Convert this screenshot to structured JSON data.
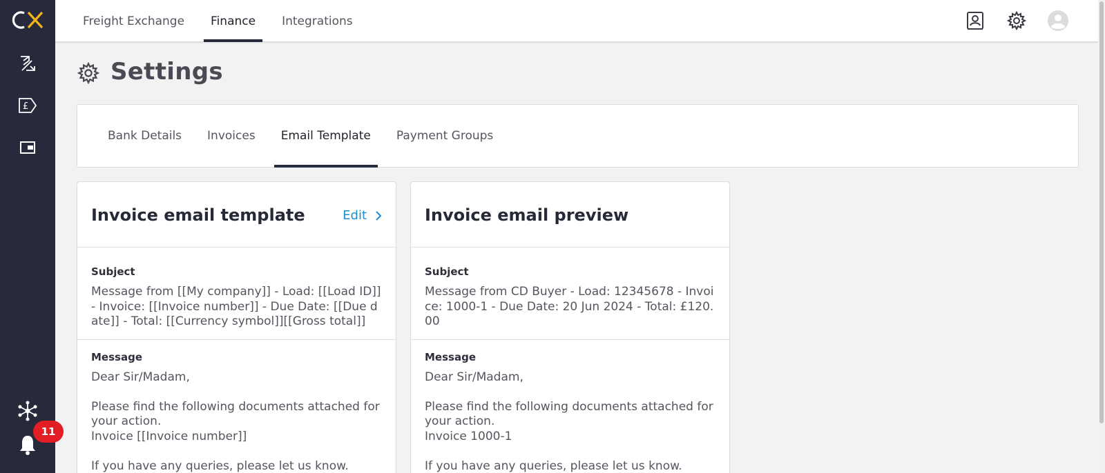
{
  "app": {
    "logo_text": "CX"
  },
  "topnav": {
    "items": [
      {
        "label": "Freight Exchange",
        "active": false
      },
      {
        "label": "Finance",
        "active": true
      },
      {
        "label": "Integrations",
        "active": false
      }
    ]
  },
  "rail": {
    "notifications_count": "11"
  },
  "page": {
    "title": "Settings"
  },
  "tabs": [
    {
      "label": "Bank Details",
      "active": false
    },
    {
      "label": "Invoices",
      "active": false
    },
    {
      "label": "Email Template",
      "active": true
    },
    {
      "label": "Payment Groups",
      "active": false
    }
  ],
  "template_card": {
    "title": "Invoice email template",
    "edit_label": "Edit",
    "subject_label": "Subject",
    "subject_value": "Message from [[My company]] - Load: [[Load ID]] - Invoice: [[Invoice number]] - Due Date: [[Due date]] - Total: [[Currency symbol]][[Gross total]]",
    "message_label": "Message",
    "message_value": "Dear Sir/Madam,\n\nPlease find the following documents attached for your action.\nInvoice [[Invoice number]]\n\nIf you have any queries, please let us know."
  },
  "preview_card": {
    "title": "Invoice email preview",
    "subject_label": "Subject",
    "subject_value": "Message from CD Buyer - Load: 12345678 - Invoice: 1000-1 - Due Date: 20 Jun 2024 - Total: £120.00",
    "message_label": "Message",
    "message_value": "Dear Sir/Madam,\n\nPlease find the following documents attached for your action.\nInvoice 1000-1\n\nIf you have any queries, please let us know."
  },
  "colors": {
    "rail": "#262a3a",
    "accent_link": "#1a8ed6",
    "logo_x": "#f5b41a",
    "badge": "#e21d24"
  }
}
